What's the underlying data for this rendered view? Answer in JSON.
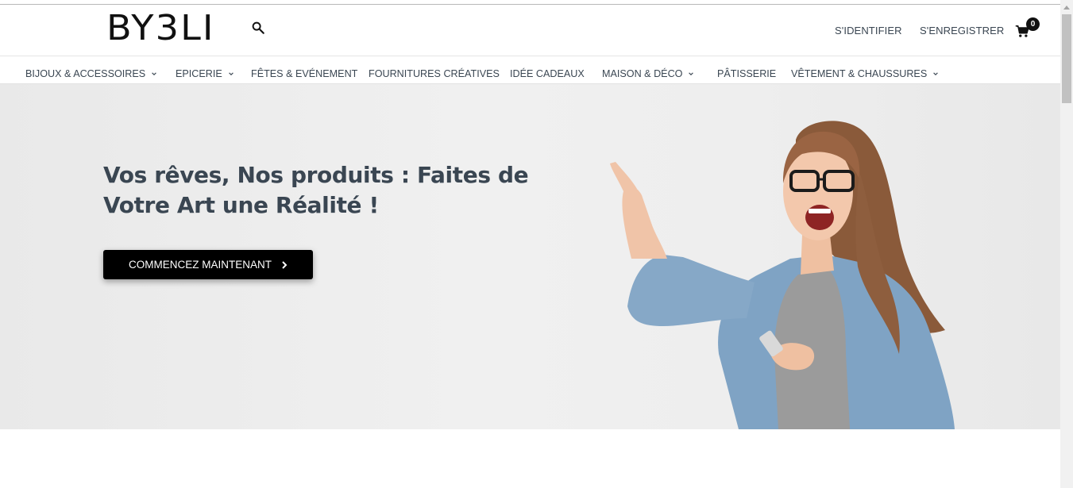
{
  "header": {
    "logo_text": "BY3LI",
    "login_label": "S'IDENTIFIER",
    "register_label": "S'ENREGISTRER",
    "cart_count": "0"
  },
  "nav": {
    "items": [
      {
        "label": "BIJOUX & ACCESSOIRES",
        "has_dropdown": true
      },
      {
        "label": "EPICERIE",
        "has_dropdown": true
      },
      {
        "label": "FÊTES & EVÉNEMENT",
        "has_dropdown": false
      },
      {
        "label": "FOURNITURES CRÉATIVES",
        "has_dropdown": false
      },
      {
        "label": "IDÉE CADEAUX",
        "has_dropdown": false
      },
      {
        "label": "MAISON & DÉCO",
        "has_dropdown": true
      },
      {
        "label": "PÂTISSERIE",
        "has_dropdown": false
      },
      {
        "label": "VÊTEMENT & CHAUSSURES",
        "has_dropdown": true
      }
    ]
  },
  "hero": {
    "title": "Vos rêves, Nos produits : Faites de Votre Art une Réalité !",
    "cta_label": "COMMENCEZ MAINTENANT"
  },
  "icons": {
    "search": "search-icon",
    "cart": "cart-icon",
    "chevron": "chevron-down-icon",
    "cta_arrow": "chevron-right-icon"
  },
  "colors": {
    "text": "#3a4652",
    "cta_bg": "#000000",
    "hero_bg": "#eeeeee"
  }
}
